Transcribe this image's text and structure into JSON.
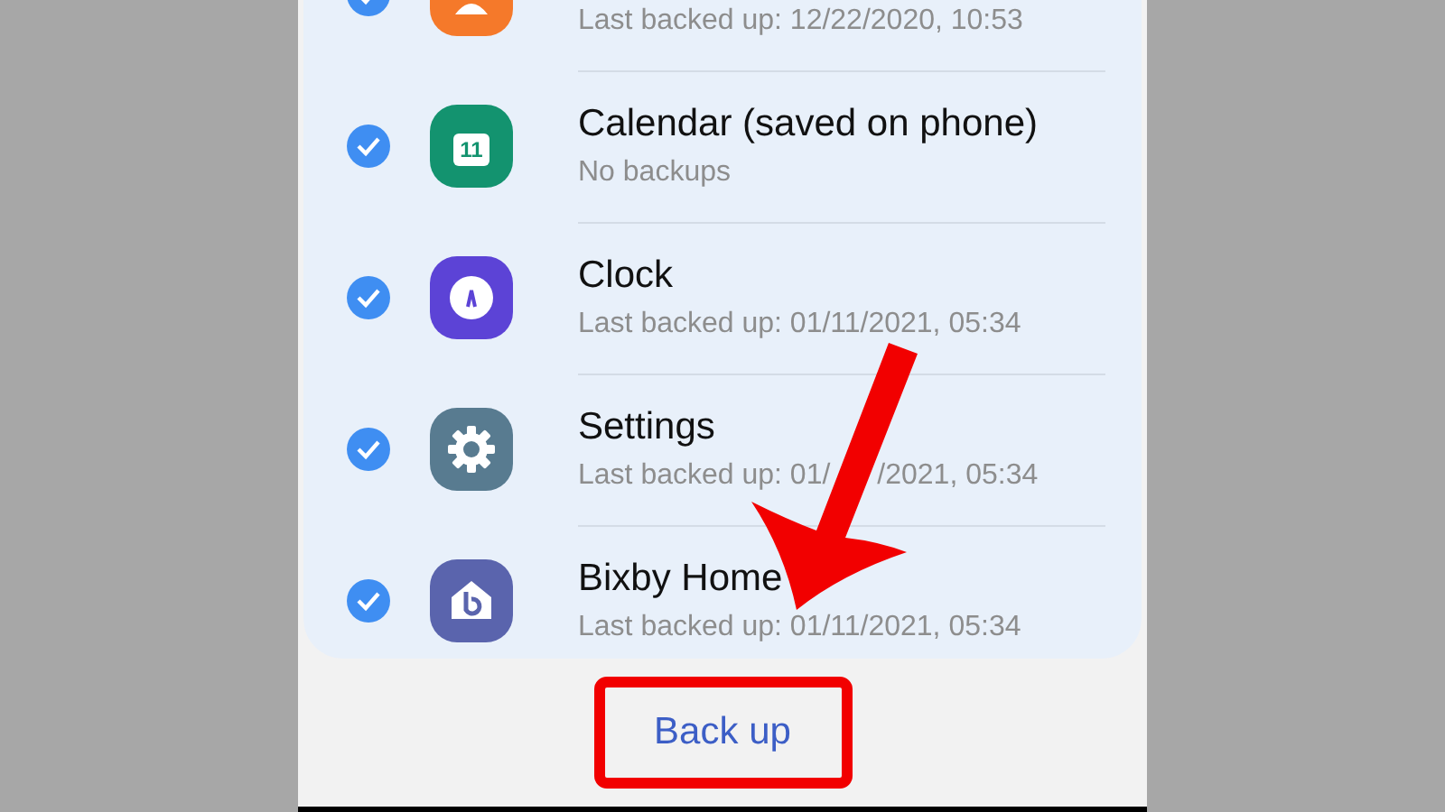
{
  "items": [
    {
      "kind": "person",
      "color": "#f5792a",
      "checked": true,
      "subtitle": "Last backed up: 12/22/2020, 10:53"
    },
    {
      "kind": "calendar",
      "color": "#13936f",
      "checked": true,
      "title": "Calendar (saved on phone)",
      "subtitle": "No backups",
      "icon_text": "11"
    },
    {
      "kind": "clock",
      "color": "#5c43d6",
      "checked": true,
      "title": "Clock",
      "subtitle": "Last backed up: 01/11/2021, 05:34"
    },
    {
      "kind": "gear",
      "color": "#587b90",
      "checked": true,
      "title": "Settings",
      "subtitle_parts": [
        "Last backed up: 01/",
        "/2021, 05:34"
      ]
    },
    {
      "kind": "home",
      "color": "#5a64ad",
      "checked": true,
      "title": "Bixby Home",
      "subtitle": "Last backed up: 01/11/2021, 05:34"
    }
  ],
  "button": {
    "label": "Back up"
  }
}
